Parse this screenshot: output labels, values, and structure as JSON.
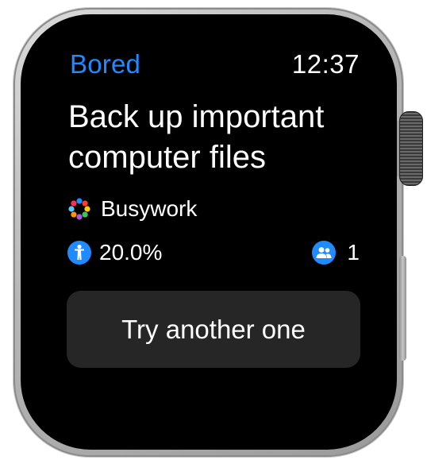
{
  "app": {
    "title": "Bored",
    "time": "12:37"
  },
  "activity": {
    "title": "Back up important computer files",
    "type": {
      "label": "Busywork",
      "icon": "multicolor-dots-icon"
    },
    "accessibility": {
      "value": "20.0%",
      "icon": "accessibility-person-icon"
    },
    "participants": {
      "value": "1",
      "icon": "people-icon"
    }
  },
  "actions": {
    "next_label": "Try another one"
  },
  "colors": {
    "accent": "#1f8bff",
    "background": "#000000",
    "button_background": "#262626",
    "text": "#ffffff",
    "dot_colors": [
      "#1f8bff",
      "#ff3b30",
      "#ffcc00",
      "#34c759",
      "#af52de",
      "#ff9500",
      "#5ac8fa",
      "#ff2d55"
    ]
  }
}
